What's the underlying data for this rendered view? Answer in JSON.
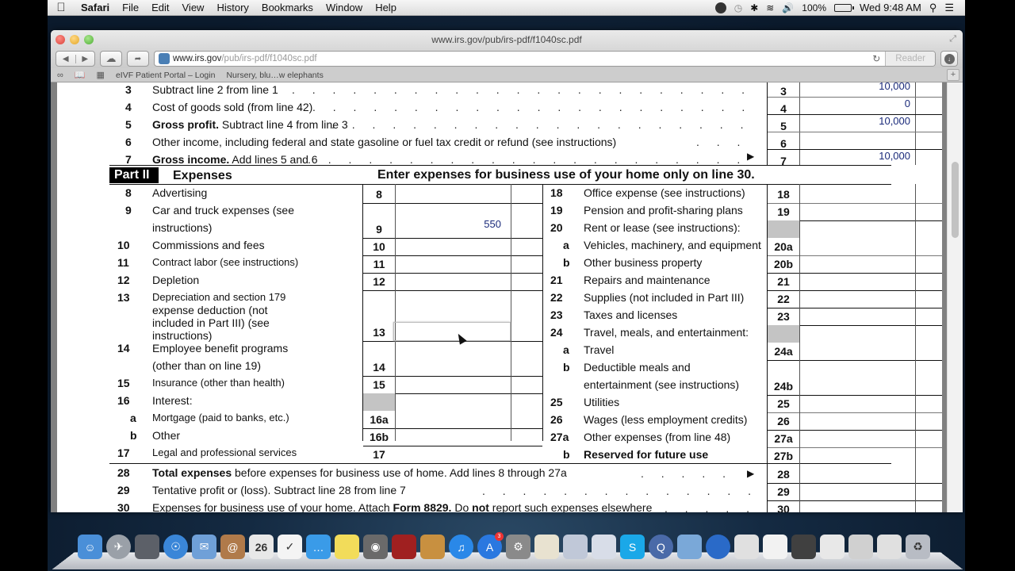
{
  "menubar": {
    "app": "Safari",
    "items": [
      "File",
      "Edit",
      "View",
      "History",
      "Bookmarks",
      "Window",
      "Help"
    ],
    "battery": "100%",
    "clock": "Wed 9:48 AM"
  },
  "window": {
    "title": "www.irs.gov/pub/irs-pdf/f1040sc.pdf",
    "address_host": "www.irs.gov",
    "address_path": "/pub/irs-pdf/f1040sc.pdf",
    "reader_label": "Reader",
    "bookmarks": [
      "eIVF Patient Portal – Login",
      "Nursery, blu…w elephants"
    ]
  },
  "form": {
    "top_lines": [
      {
        "num": "3",
        "label": "Subtract line 2 from line 1",
        "box": "3",
        "value": "10,000"
      },
      {
        "num": "4",
        "label": "Cost of goods sold (from line 42)",
        "box": "4",
        "value": "0"
      },
      {
        "num": "5",
        "label_bold": "Gross profit.",
        "label": " Subtract line 4 from line 3",
        "box": "5",
        "value": "10,000"
      },
      {
        "num": "6",
        "label": "Other income, including federal and state gasoline or fuel tax credit or refund (see instructions)",
        "box": "6",
        "value": ""
      },
      {
        "num": "7",
        "label_bold": "Gross income.",
        "label": " Add lines 5 and 6",
        "box": "7",
        "value": "10,000"
      }
    ],
    "part_label": "Part II",
    "part_title": "Expenses",
    "part_note": "Enter expenses for business use of your home only on line 30.",
    "left_lines": [
      {
        "num": "8",
        "label": "Advertising",
        "box": "8",
        "value": ""
      },
      {
        "num": "9",
        "label": "Car and truck expenses (see",
        "label2": "instructions)",
        "box": "9",
        "value": "550"
      },
      {
        "num": "10",
        "label": "Commissions and fees",
        "box": "10",
        "value": ""
      },
      {
        "num": "11",
        "label": "Contract labor (see instructions)",
        "box": "11",
        "value": ""
      },
      {
        "num": "12",
        "label": "Depletion",
        "box": "12",
        "value": ""
      },
      {
        "num": "13",
        "label": "Depreciation and section 179",
        "label2": "expense deduction (not",
        "label3": "included in Part III) (see",
        "label4": "instructions)",
        "box": "13",
        "value": ""
      },
      {
        "num": "14",
        "label": "Employee benefit programs",
        "label2": "(other than on line 19)",
        "box": "14",
        "value": ""
      },
      {
        "num": "15",
        "label": "Insurance (other than health)",
        "box": "15",
        "value": ""
      },
      {
        "num": "16",
        "label": "Interest:",
        "box": "",
        "value": ""
      },
      {
        "num": "a",
        "label": "Mortgage (paid to banks, etc.)",
        "box": "16a",
        "value": ""
      },
      {
        "num": "b",
        "label": "Other",
        "box": "16b",
        "value": ""
      },
      {
        "num": "17",
        "label": "Legal and professional services",
        "box": "17",
        "value": ""
      }
    ],
    "right_lines": [
      {
        "num": "18",
        "label": "Office expense (see instructions)",
        "box": "18"
      },
      {
        "num": "19",
        "label": "Pension and profit-sharing plans",
        "box": "19"
      },
      {
        "num": "20",
        "label": "Rent or lease (see instructions):",
        "box": ""
      },
      {
        "num": "a",
        "label": "Vehicles, machinery, and equipment",
        "box": "20a"
      },
      {
        "num": "b",
        "label": "Other business property",
        "box": "20b"
      },
      {
        "num": "21",
        "label": "Repairs and maintenance",
        "box": "21"
      },
      {
        "num": "22",
        "label": "Supplies (not included in Part III)",
        "box": "22"
      },
      {
        "num": "23",
        "label": "Taxes and licenses",
        "box": "23"
      },
      {
        "num": "24",
        "label": "Travel, meals, and entertainment:",
        "box": ""
      },
      {
        "num": "a",
        "label": "Travel",
        "box": "24a"
      },
      {
        "num": "b",
        "label": "Deductible meals and",
        "label2": "entertainment (see instructions)",
        "box": "24b"
      },
      {
        "num": "25",
        "label": "Utilities",
        "box": "25"
      },
      {
        "num": "26",
        "label": "Wages (less employment credits)",
        "box": "26"
      },
      {
        "num": "27a",
        "label": "Other expenses (from line 48)",
        "box": "27a"
      },
      {
        "num": "b",
        "label": "Reserved for future use",
        "box": "27b"
      }
    ],
    "bottom_lines": [
      {
        "num": "28",
        "label_bold": "Total expenses",
        "label": " before expenses for business use of home. Add lines 8 through 27a",
        "box": "28"
      },
      {
        "num": "29",
        "label": "Tentative profit or (loss). Subtract line 28 from line 7",
        "box": "29"
      },
      {
        "num": "30",
        "label": "Expenses for business use of your home. Attach ",
        "label_bold2": "Form 8829.",
        "label_mid": " Do ",
        "label_bold3": "not",
        "label_end": " report such expenses elsewhere",
        "box": "30"
      }
    ]
  },
  "dock": {
    "apps": [
      "Finder",
      "Launchpad",
      "Mission Control",
      "Safari",
      "Mail",
      "Contacts",
      "Calendar",
      "Reminders",
      "Messages",
      "Notes",
      "FaceTime",
      "Photo Booth",
      "iPhoto",
      "iTunes",
      "App Store",
      "System Preferences",
      "TextEdit",
      "Preview",
      "Image Capture",
      "Skype",
      "QuickTime Player",
      "Applications",
      "App Store Downloads",
      "Document",
      "Document",
      "Document",
      "Document",
      "Document",
      "Document",
      "Trash"
    ],
    "calendar_day": "26",
    "appstore_badge": "3"
  }
}
